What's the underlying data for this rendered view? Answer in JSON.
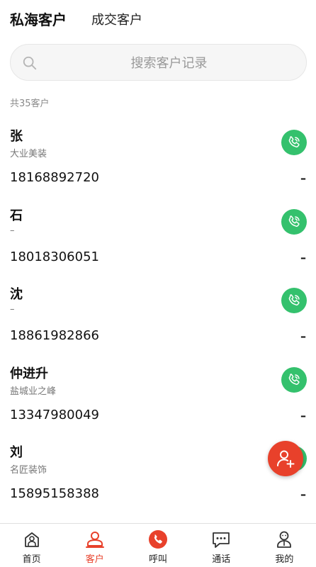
{
  "header": {
    "tabs": [
      {
        "label": "私海客户",
        "active": true
      },
      {
        "label": "成交客户",
        "active": false
      }
    ]
  },
  "search": {
    "placeholder": "搜索客户记录",
    "icon": "search-icon"
  },
  "summary": {
    "total_text": "共35客户"
  },
  "customers": [
    {
      "name": "张",
      "company": "大业美装",
      "phone": "18168892720",
      "status": "–"
    },
    {
      "name": "石",
      "company": "–",
      "phone": "18018306051",
      "status": "–"
    },
    {
      "name": "沈",
      "company": "–",
      "phone": "18861982866",
      "status": "–"
    },
    {
      "name": "仲进升",
      "company": "盐城业之峰",
      "phone": "13347980049",
      "status": "–"
    },
    {
      "name": "刘",
      "company": "名匠装饰",
      "phone": "15895158388",
      "status": "–"
    }
  ],
  "fab": {
    "icon": "add-user-icon"
  },
  "bottom_nav": [
    {
      "label": "首页",
      "icon": "home-icon",
      "active": false
    },
    {
      "label": "客户",
      "icon": "customer-icon",
      "active": true
    },
    {
      "label": "呼叫",
      "icon": "phone-call-icon",
      "active": false
    },
    {
      "label": "通话",
      "icon": "chat-icon",
      "active": false
    },
    {
      "label": "我的",
      "icon": "profile-icon",
      "active": false
    }
  ],
  "colors": {
    "accent": "#e8412b",
    "call_green": "#34c16d"
  }
}
